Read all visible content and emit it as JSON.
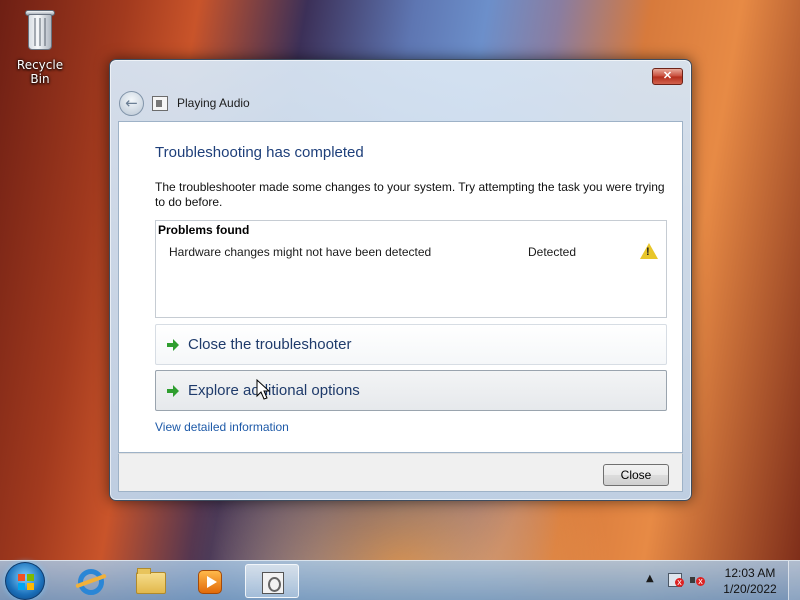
{
  "desktop": {
    "recycle_bin_label": "Recycle Bin"
  },
  "window": {
    "close_glyph": "✕",
    "back_glyph": "←",
    "title": "Playing Audio",
    "heading": "Troubleshooting has completed",
    "description": "The troubleshooter made some changes to your system. Try attempting the task you were trying to do before.",
    "problems": {
      "header": "Problems found",
      "items": [
        {
          "text": "Hardware changes might not have been detected",
          "status": "Detected",
          "icon": "warning-icon"
        }
      ]
    },
    "commands": [
      {
        "label": "Close the troubleshooter",
        "icon": "green-arrow-icon"
      },
      {
        "label": "Explore additional options",
        "icon": "green-arrow-icon"
      }
    ],
    "detail_link": "View detailed information",
    "close_button": "Close"
  },
  "taskbar": {
    "pinned": [
      "start-button",
      "internet-explorer-icon",
      "folder-icon",
      "media-player-icon",
      "troubleshooter-icon"
    ],
    "tray_up_glyph": "▲",
    "clock_time": "12:03 AM",
    "clock_date": "1/20/2022"
  },
  "colors": {
    "heading": "#1e3f7a",
    "link": "#1e5aa8",
    "command_text": "#1f3b6b",
    "arrow_green": "#2f9e2f",
    "warning_yellow": "#e8c62a"
  }
}
